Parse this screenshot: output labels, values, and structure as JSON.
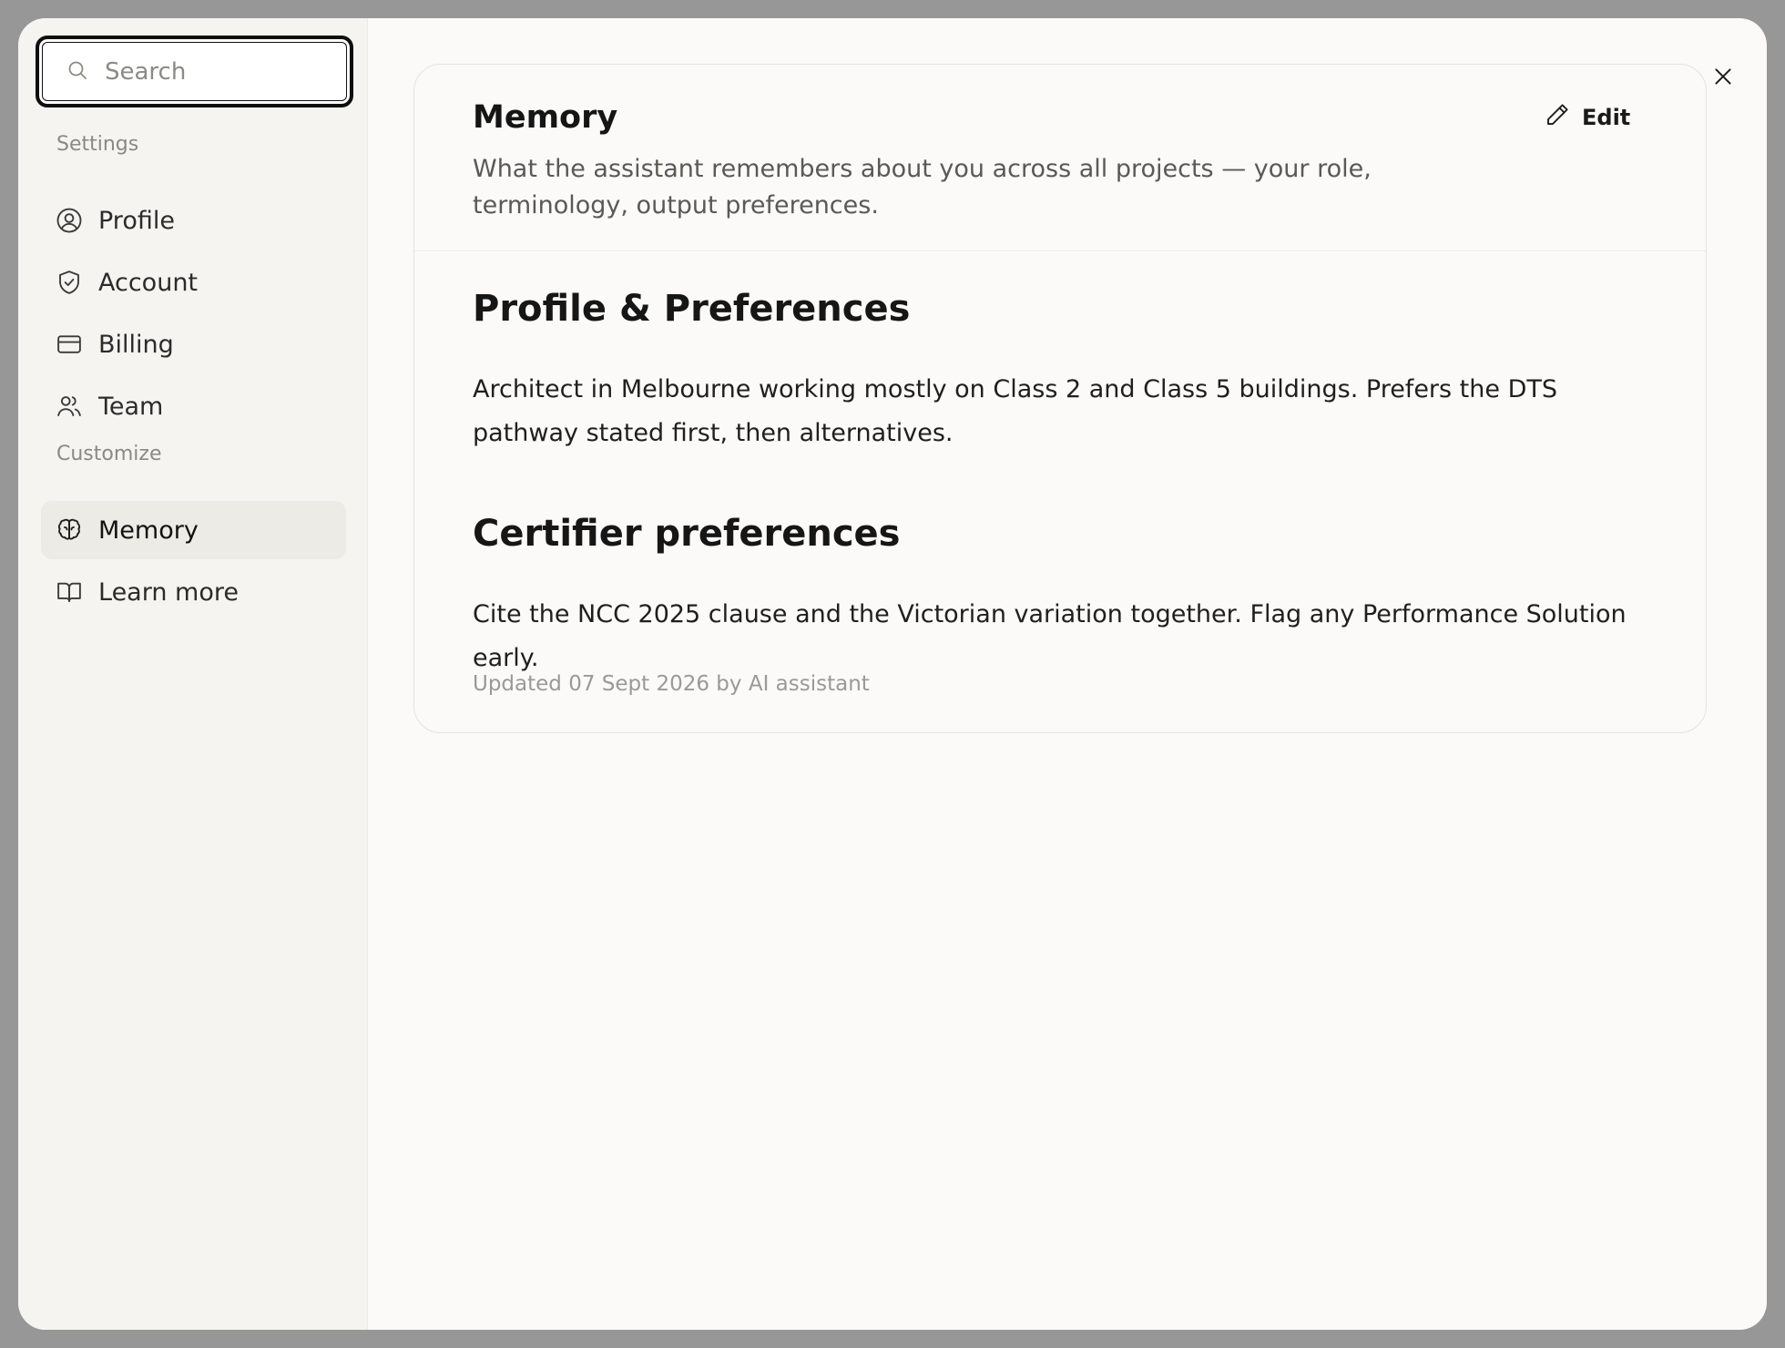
{
  "search": {
    "placeholder": "Search"
  },
  "sidebar": {
    "settings_label": "Settings",
    "customize_label": "Customize",
    "items": [
      {
        "label": "Profile",
        "icon": "user-circle-icon"
      },
      {
        "label": "Account",
        "icon": "shield-icon"
      },
      {
        "label": "Billing",
        "icon": "credit-card-icon"
      },
      {
        "label": "Team",
        "icon": "users-icon"
      },
      {
        "label": "Memory",
        "icon": "brain-icon",
        "active": true
      },
      {
        "label": "Learn more",
        "icon": "book-icon"
      }
    ]
  },
  "memory": {
    "title": "Memory",
    "description": "What the assistant remembers about you across all projects — your role, terminology, output preferences.",
    "edit_label": "Edit",
    "sections": [
      {
        "heading": "Profile & Preferences",
        "body": "Architect in Melbourne working mostly on Class 2 and Class 5 buildings. Prefers the DTS pathway stated first, then alternatives."
      },
      {
        "heading": "Certifier preferences",
        "body": "Cite the NCC 2025 clause and the Victorian variation together. Flag any Performance Solution early."
      }
    ],
    "updated": "Updated 07 Sept 2026 by AI assistant"
  },
  "colors": {
    "backdrop": "#979797",
    "modal_bg": "#fbfaf8",
    "sidebar_bg": "#f5f4f0",
    "active_item_bg": "#ecebe5",
    "text_primary": "#151515",
    "text_muted": "#8a8985"
  }
}
